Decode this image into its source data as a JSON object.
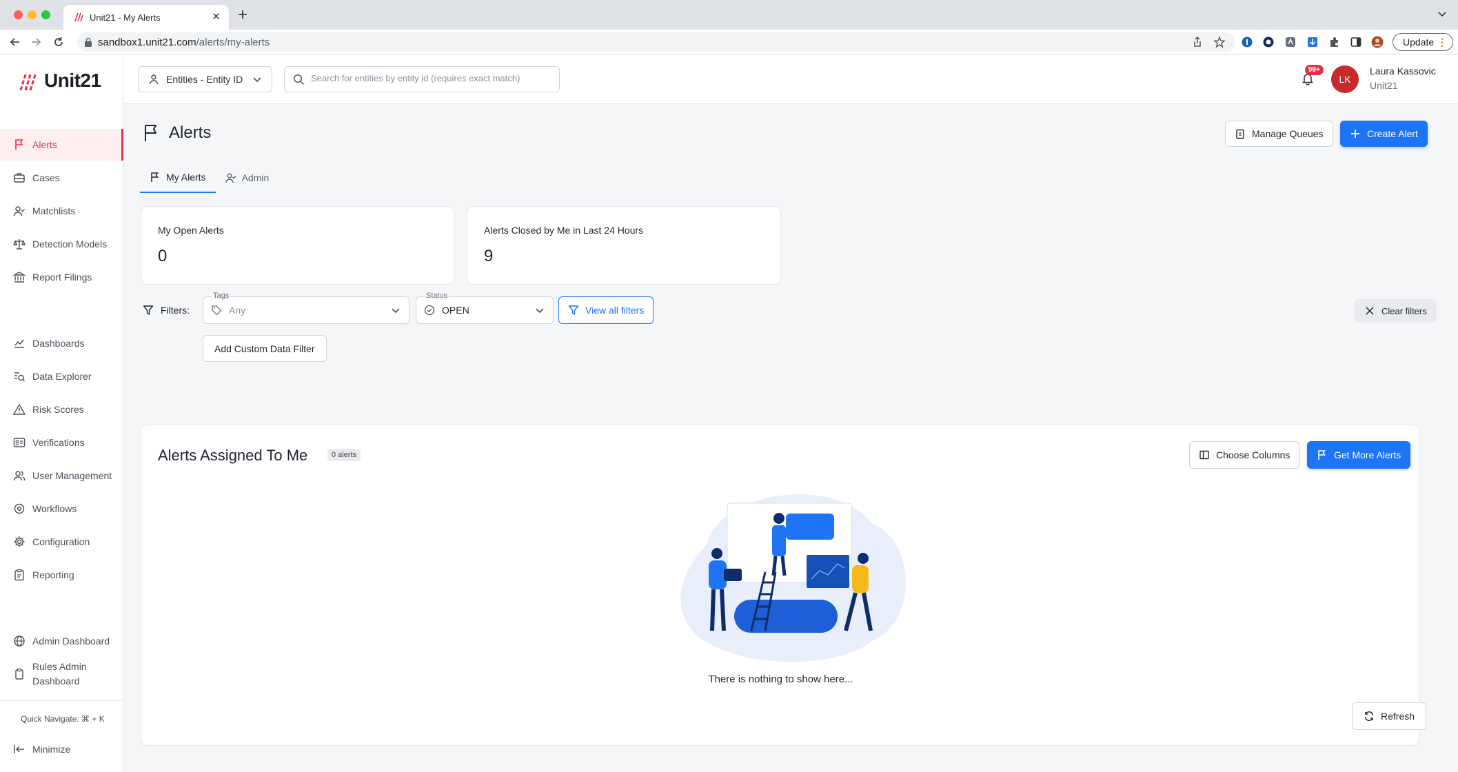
{
  "browser": {
    "tab_title": "Unit21 - My Alerts",
    "url_host": "sandbox1.unit21.com",
    "url_path": "/alerts/my-alerts",
    "update_label": "Update"
  },
  "brand": {
    "name": "Unit21",
    "accent": "#e0334a",
    "primary": "#1d74f5"
  },
  "sidebar": {
    "items": [
      {
        "label": "Alerts",
        "icon": "flag-icon"
      },
      {
        "label": "Cases",
        "icon": "briefcase-icon"
      },
      {
        "label": "Matchlists",
        "icon": "user-check-icon"
      },
      {
        "label": "Detection Models",
        "icon": "scale-icon"
      },
      {
        "label": "Report Filings",
        "icon": "bank-icon"
      },
      {
        "label": "Dashboards",
        "icon": "line-chart-icon"
      },
      {
        "label": "Data Explorer",
        "icon": "search-data-icon"
      },
      {
        "label": "Risk Scores",
        "icon": "warning-triangle-icon"
      },
      {
        "label": "Verifications",
        "icon": "id-card-icon"
      },
      {
        "label": "User Management",
        "icon": "users-icon"
      },
      {
        "label": "Workflows",
        "icon": "workflow-gear-icon"
      },
      {
        "label": "Configuration",
        "icon": "gear-icon"
      },
      {
        "label": "Reporting",
        "icon": "clipboard-icon"
      },
      {
        "label": "Admin Dashboard",
        "icon": "globe-icon"
      },
      {
        "label": "Rules Admin Dashboard",
        "icon": "clipboard-small-icon"
      }
    ],
    "quick_navigate": "Quick Navigate: ⌘ + K",
    "minimize": "Minimize"
  },
  "topbar": {
    "entity_select": "Entities - Entity ID",
    "search_placeholder": "Search for entities by entity id (requires exact match)",
    "notification_badge": "99+",
    "avatar_initials": "LK",
    "user_name": "Laura Kassovic",
    "user_org": "Unit21"
  },
  "page": {
    "title": "Alerts",
    "manage_queues": "Manage Queues",
    "create_alert": "Create Alert",
    "tabs": [
      {
        "label": "My Alerts",
        "active": true
      },
      {
        "label": "Admin",
        "active": false
      }
    ]
  },
  "stats": [
    {
      "label": "My Open Alerts",
      "value": "0"
    },
    {
      "label": "Alerts Closed by Me in Last 24 Hours",
      "value": "9"
    }
  ],
  "filters": {
    "label": "Filters:",
    "tags_legend": "Tags",
    "tags_value": "Any",
    "status_legend": "Status",
    "status_value": "OPEN",
    "view_all": "View all filters",
    "clear": "Clear filters",
    "add_custom": "Add Custom Data Filter"
  },
  "panel": {
    "title": "Alerts Assigned To Me",
    "count": "0 alerts",
    "choose_columns": "Choose Columns",
    "get_more": "Get More Alerts",
    "empty_text": "There is nothing to show here...",
    "refresh": "Refresh"
  }
}
